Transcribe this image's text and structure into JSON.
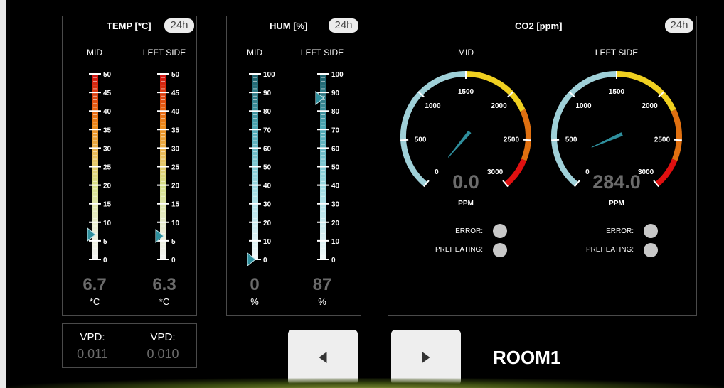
{
  "temp": {
    "title": "TEMP [*C]",
    "badge": "24h",
    "mid": {
      "label": "MID",
      "value_text": "6.7",
      "unit": "*C",
      "value": 6.7
    },
    "left": {
      "label": "LEFT SIDE",
      "value_text": "6.3",
      "unit": "*C",
      "value": 6.3
    },
    "ticks": [
      "50",
      "45",
      "40",
      "35",
      "30",
      "25",
      "20",
      "15",
      "10",
      "5",
      "0"
    ],
    "range": [
      0,
      50
    ]
  },
  "hum": {
    "title": "HUM [%]",
    "badge": "24h",
    "mid": {
      "label": "MID",
      "value_text": "0",
      "unit": "%",
      "value": 0
    },
    "left": {
      "label": "LEFT SIDE",
      "value_text": "87",
      "unit": "%",
      "value": 87
    },
    "ticks": [
      "100",
      "90",
      "80",
      "70",
      "60",
      "50",
      "40",
      "30",
      "20",
      "10",
      "0"
    ],
    "range": [
      0,
      100
    ]
  },
  "co2": {
    "title": "CO2 [ppm]",
    "badge": "24h",
    "range": [
      0,
      3000
    ],
    "gauge_ticks": [
      "0",
      "500",
      "1000",
      "1500",
      "2000",
      "2500",
      "3000"
    ],
    "mid": {
      "label": "MID",
      "value_text": "0.0",
      "unit": "PPM",
      "value": 0,
      "error_label": "ERROR:",
      "preheating_label": "PREHEATING:"
    },
    "left": {
      "label": "LEFT SIDE",
      "value_text": "284.0",
      "unit": "PPM",
      "value": 284,
      "error_label": "ERROR:",
      "preheating_label": "PREHEATING:"
    }
  },
  "vpd": {
    "mid": {
      "label": "VPD:",
      "value": "0.011"
    },
    "left": {
      "label": "VPD:",
      "value": "0.010"
    }
  },
  "nav": {
    "room": "ROOM1"
  },
  "colors": {
    "accent_teal": "#2f8f9d",
    "gauge_light": "#9fd0d8",
    "gauge_yellow": "#f0d020",
    "gauge_orange": "#e07010",
    "gauge_red": "#e01010"
  }
}
